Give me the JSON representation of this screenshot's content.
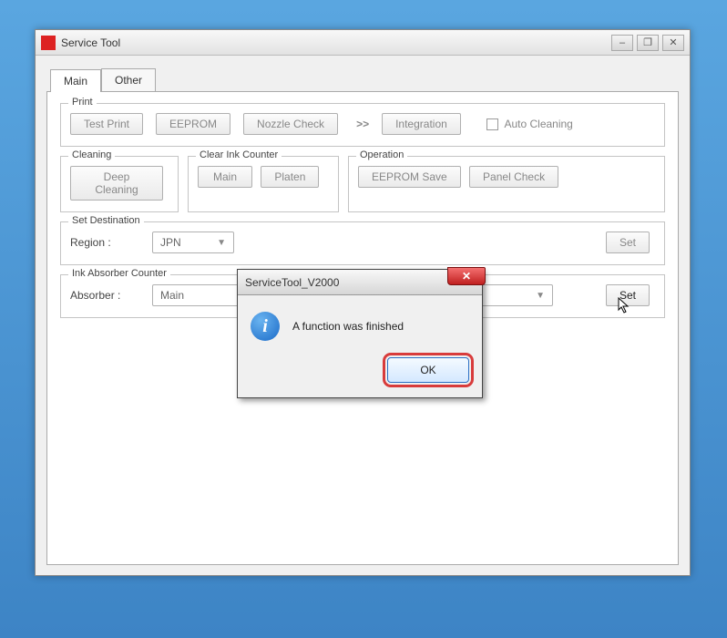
{
  "window": {
    "title": "Service Tool",
    "minimize": "–",
    "maximize": "❐",
    "close": "✕"
  },
  "tabs": {
    "main": "Main",
    "other": "Other"
  },
  "print": {
    "legend": "Print",
    "test_print": "Test Print",
    "eeprom": "EEPROM",
    "nozzle_check": "Nozzle Check",
    "more": ">>",
    "integration": "Integration",
    "auto_cleaning": "Auto Cleaning"
  },
  "cleaning": {
    "legend": "Cleaning",
    "deep_cleaning": "Deep Cleaning"
  },
  "clear_ink": {
    "legend": "Clear Ink Counter",
    "main": "Main",
    "platen": "Platen"
  },
  "operation": {
    "legend": "Operation",
    "eeprom_save": "EEPROM Save",
    "panel_check": "Panel Check"
  },
  "set_dest": {
    "legend": "Set Destination",
    "region_label": "Region :",
    "region_value": "JPN",
    "set": "Set"
  },
  "ink_abs": {
    "legend": "Ink Absorber Counter",
    "absorber_label": "Absorber :",
    "absorber_value": "Main",
    "set": "Set"
  },
  "dialog": {
    "title": "ServiceTool_V2000",
    "message": "A function was finished",
    "ok": "OK",
    "close": "✕"
  }
}
